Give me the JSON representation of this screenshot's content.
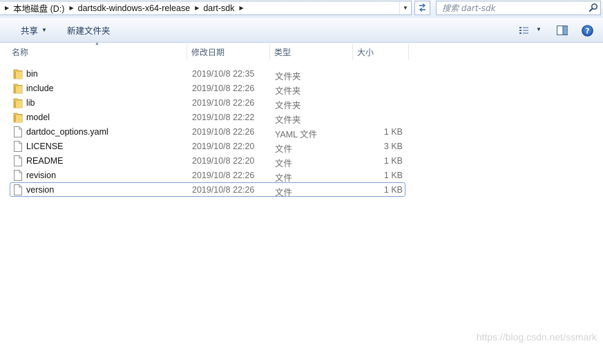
{
  "address": {
    "crumbs": [
      "本地磁盘 (D:)",
      "dartsdk-windows-x64-release",
      "dart-sdk"
    ],
    "search_placeholder": "搜索 dart-sdk"
  },
  "toolbar": {
    "share_label": "共享",
    "new_folder_label": "新建文件夹"
  },
  "columns": {
    "name": "名称",
    "date": "修改日期",
    "type": "类型",
    "size": "大小"
  },
  "files": [
    {
      "name": "bin",
      "date": "2019/10/8 22:35",
      "type": "文件夹",
      "size": "",
      "icon": "folder-icon"
    },
    {
      "name": "include",
      "date": "2019/10/8 22:26",
      "type": "文件夹",
      "size": "",
      "icon": "folder-icon"
    },
    {
      "name": "lib",
      "date": "2019/10/8 22:26",
      "type": "文件夹",
      "size": "",
      "icon": "folder-icon"
    },
    {
      "name": "model",
      "date": "2019/10/8 22:22",
      "type": "文件夹",
      "size": "",
      "icon": "folder-icon"
    },
    {
      "name": "dartdoc_options.yaml",
      "date": "2019/10/8 22:26",
      "type": "YAML 文件",
      "size": "1 KB",
      "icon": "file-icon"
    },
    {
      "name": "LICENSE",
      "date": "2019/10/8 22:20",
      "type": "文件",
      "size": "3 KB",
      "icon": "file-icon"
    },
    {
      "name": "README",
      "date": "2019/10/8 22:20",
      "type": "文件",
      "size": "1 KB",
      "icon": "file-icon"
    },
    {
      "name": "revision",
      "date": "2019/10/8 22:26",
      "type": "文件",
      "size": "1 KB",
      "icon": "file-icon"
    },
    {
      "name": "version",
      "date": "2019/10/8 22:26",
      "type": "文件",
      "size": "1 KB",
      "icon": "file-icon"
    }
  ],
  "watermark": "https://blog.csdn.net/ssmark",
  "colors": {
    "toolbar_text": "#1e395b",
    "selection_border": "#7da2ce",
    "folder": "#e8c45a"
  }
}
